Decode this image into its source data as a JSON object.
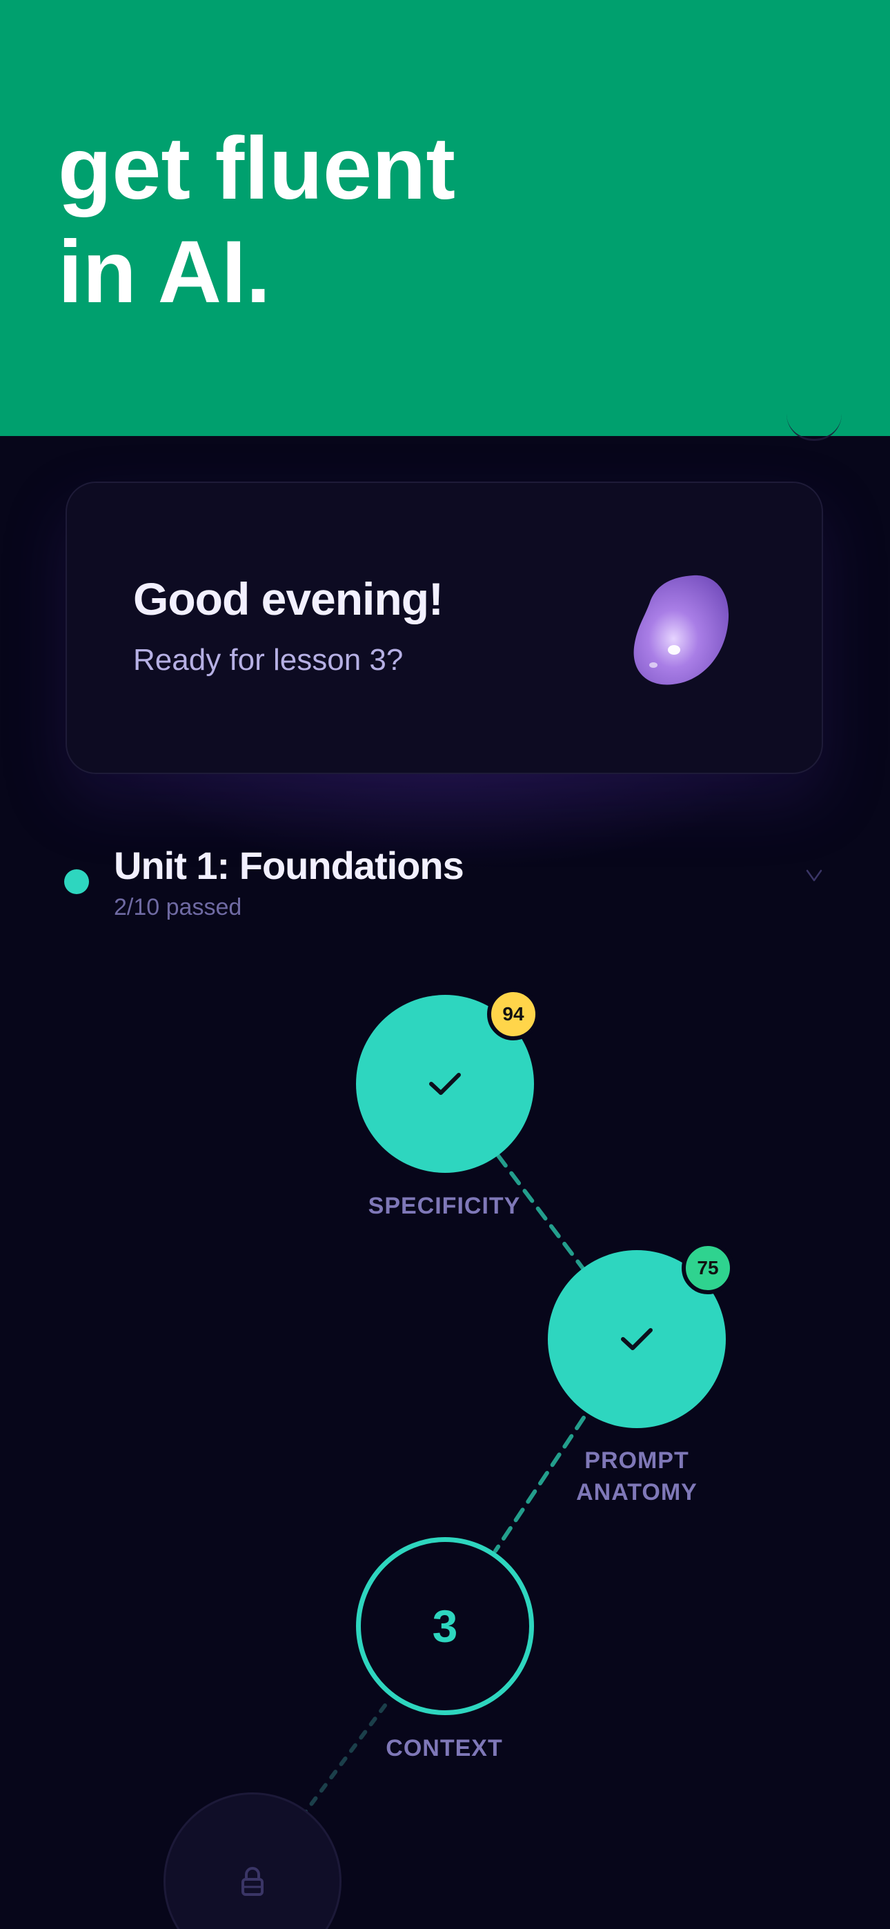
{
  "banner": {
    "title_line1": "get fluent",
    "title_line2": "in AI.",
    "background": "#00a06e"
  },
  "greeting": {
    "title": "Good evening!",
    "subtitle": "Ready for lesson 3?",
    "mascot_icon": "purple-blob-mascot"
  },
  "unit": {
    "title": "Unit 1: Foundations",
    "progress": "2/10 passed",
    "status_color": "#2ed6bf",
    "toggle_icon": "chevron-down-icon"
  },
  "lessons": [
    {
      "label": "SPECIFICITY",
      "status": "completed",
      "score": "94",
      "score_color": "#ffd54a",
      "icon": "check-icon"
    },
    {
      "label_line1": "PROMPT",
      "label_line2": "ANATOMY",
      "status": "completed",
      "score": "75",
      "score_color": "#2fd38f",
      "icon": "check-icon"
    },
    {
      "label": "CONTEXT",
      "status": "current",
      "number": "3"
    },
    {
      "status": "locked",
      "icon": "lock-icon"
    }
  ],
  "colors": {
    "accent": "#2ed6bf",
    "background": "#07061a",
    "card": "#0d0b22",
    "label": "#7f78b8"
  }
}
